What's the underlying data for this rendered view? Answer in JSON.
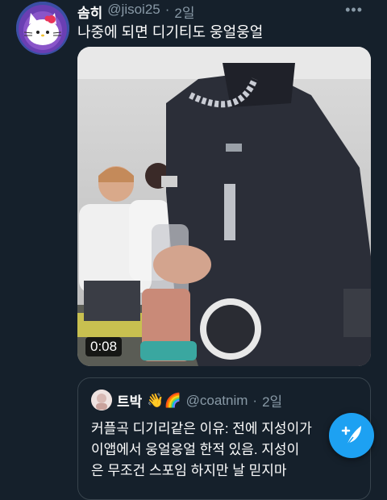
{
  "tweet": {
    "display_name": "솜히",
    "handle": "@jisoi25",
    "separator": "·",
    "time": "2일",
    "text": "나중에 되면 디기티도 웅얼웅얼",
    "avatar_icon": "hello-kitty-avatar",
    "more_icon": "more-dots-icon"
  },
  "media": {
    "duration": "0:08",
    "type": "video"
  },
  "quote": {
    "display_name": "트박",
    "emojis": "👋🌈",
    "handle": "@coatnim",
    "separator": "·",
    "time": "2일",
    "text_lines": [
      "커플곡 디기리같은 이유: 전에 지성이가",
      "이앱에서 웅얼웅얼 한적 있음. 지성이",
      "은 무조건 스포임 하지만 날 믿지마"
    ]
  },
  "fab": {
    "icon": "compose-tweet-icon"
  },
  "colors": {
    "background": "#15202b",
    "accent": "#1da1f2",
    "muted": "#8899a6"
  }
}
